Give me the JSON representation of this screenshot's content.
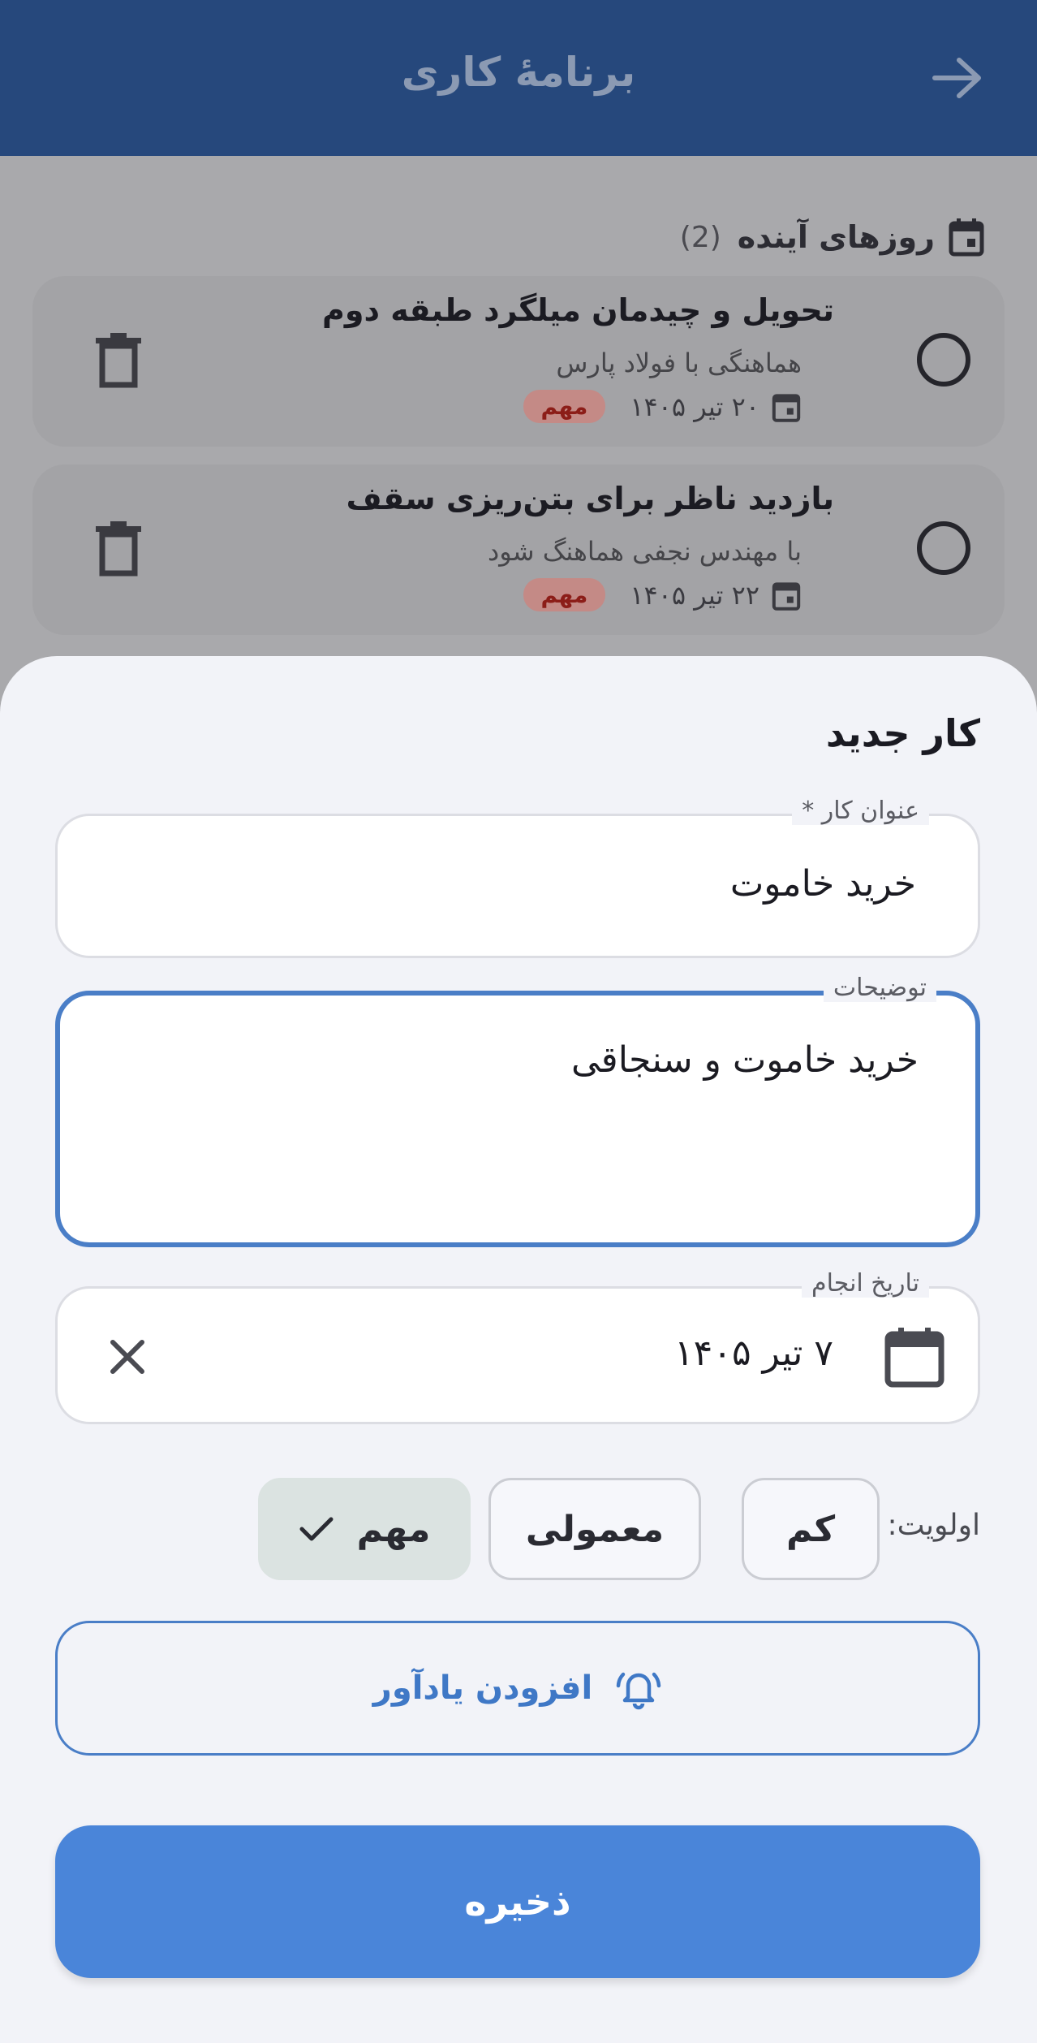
{
  "appbar": {
    "title": "برنامهٔ کاری"
  },
  "upcoming": {
    "title": "روزهای آینده",
    "count": "(2)",
    "tasks": [
      {
        "title": "تحویل و چیدمان میلگرد طبقه دوم",
        "description": "هماهنگی با فولاد پارس",
        "date": "۲۰ تیر ۱۴۰۵",
        "badge": "مهم"
      },
      {
        "title": "بازدید ناظر برای بتن‌ریزی سقف",
        "description": "با مهندس نجفی هماهنگ شود",
        "date": "۲۲ تیر ۱۴۰۵",
        "badge": "مهم"
      }
    ]
  },
  "sheet": {
    "title": "کار جدید",
    "title_field": {
      "label": "عنوان کار *",
      "value": "خرید خاموت"
    },
    "desc_field": {
      "label": "توضیحات",
      "value": "خرید خاموت و سنجاقی"
    },
    "date_field": {
      "label": "تاریخ انجام",
      "value": "۷ تیر ۱۴۰۵"
    },
    "priority": {
      "label": "اولویت:",
      "options": [
        "کم",
        "معمولی",
        "مهم"
      ],
      "selected": "مهم"
    },
    "reminder_label": "افزودن یادآور",
    "save_label": "ذخیره"
  },
  "colors": {
    "appbar": "#26487c",
    "accent": "#4a85d9",
    "focus_border": "#4a7ec7",
    "selected_chip": "#dbe3e1",
    "badge_text": "#8c1d18"
  },
  "icons": [
    "arrow-forward-icon",
    "calendar-icon",
    "trash-icon",
    "bell-icon",
    "close-icon",
    "check-icon"
  ]
}
